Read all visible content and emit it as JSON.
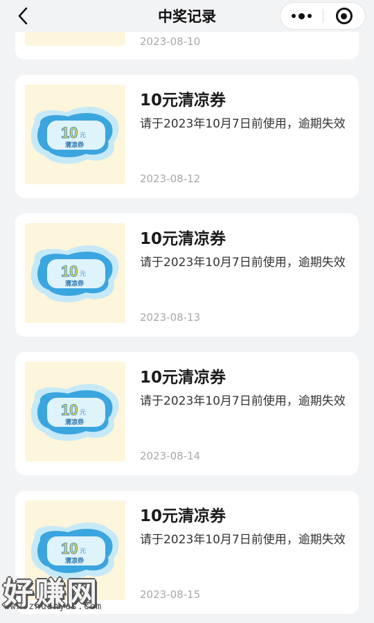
{
  "header": {
    "title": "中奖记录",
    "back_icon": "chevron-left-icon",
    "more_icon": "more-dots-icon",
    "close_icon": "target-icon"
  },
  "records": [
    {
      "title": "",
      "desc": "",
      "date": "2023-08-10"
    },
    {
      "title": "10元清凉券",
      "desc": "请于2023年10月7日前使用，逾期失效",
      "date": "2023-08-12",
      "badge_amount": "10",
      "badge_unit": "元",
      "badge_label": "清凉券"
    },
    {
      "title": "10元清凉券",
      "desc": "请于2023年10月7日前使用，逾期失效",
      "date": "2023-08-13",
      "badge_amount": "10",
      "badge_unit": "元",
      "badge_label": "清凉券"
    },
    {
      "title": "10元清凉券",
      "desc": "请于2023年10月7日前使用，逾期失效",
      "date": "2023-08-14",
      "badge_amount": "10",
      "badge_unit": "元",
      "badge_label": "清凉券"
    },
    {
      "title": "10元清凉券",
      "desc": "请于2023年10月7日前使用，逾期失效",
      "date": "2023-08-15",
      "badge_amount": "10",
      "badge_unit": "元",
      "badge_label": "清凉券"
    }
  ],
  "watermark": {
    "brand": "好赚网",
    "url": "www.zhuanyes.com"
  },
  "colors": {
    "background": "#f2f3f5",
    "thumb_bg": "#fdf6dc",
    "badge_blue": "#3aa5de",
    "badge_light": "#c6e9f7",
    "badge_text": "#e8d84a",
    "date_text": "#a8a8a8"
  }
}
